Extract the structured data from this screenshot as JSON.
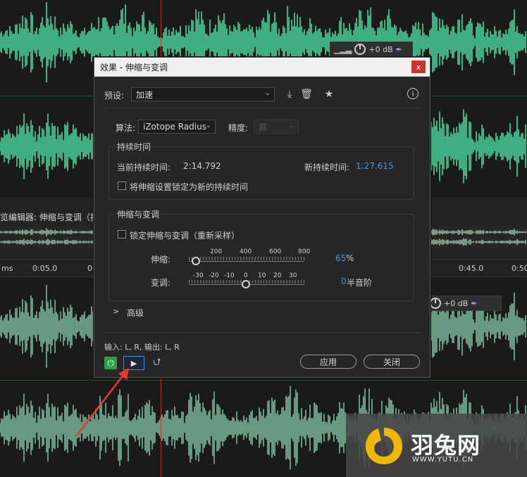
{
  "colors": {
    "wave_top": "#49d49a",
    "wave_bottom": "#7bb89c",
    "accent_blue": "#3d97e6",
    "power_green": "#2f9e4a",
    "close_red": "#c8372d"
  },
  "tracks": {
    "top_ctrl_value": "+0 dB",
    "bottom_ctrl_value": "+0 dB"
  },
  "editor": {
    "title": "览编辑器: 伸缩与变调（扫",
    "ruler_ticks": [
      "ms",
      "0:05.0",
      "0",
      "0:45.0",
      "0:50"
    ]
  },
  "dialog": {
    "title": "效果 - 伸缩与变调",
    "close": "x",
    "preset": {
      "label": "预设:",
      "value": "加速"
    },
    "algorithm": {
      "label": "算法:",
      "value": "iZotope Radius"
    },
    "precision": {
      "label": "精度:",
      "value": "高"
    },
    "duration": {
      "group_title": "持续时间",
      "current_label": "当前持续时间:",
      "current_value": "2:14.792",
      "new_label": "新持续时间:",
      "new_value": "1:27.615",
      "lock_label": "将伸缩设置锁定为新的持续时间"
    },
    "stretch_pitch": {
      "group_title": "伸缩与变调",
      "lock_label": "锁定伸缩与变调（重新采样）",
      "stretch_label": "伸缩:",
      "stretch_scale": [
        "200",
        "400",
        "600",
        "800"
      ],
      "stretch_value": "65",
      "stretch_unit": "%",
      "pitch_label": "变调:",
      "pitch_scale": [
        "-30",
        "-20",
        "-10",
        "0",
        "10",
        "20",
        "30"
      ],
      "pitch_value": "0",
      "pitch_unit": "半音阶"
    },
    "advanced": {
      "label": "高级",
      "chevron": ">"
    },
    "io": "输入: L, R,  输出: L, R",
    "apply": "应用",
    "close_btn": "关闭"
  },
  "watermark": {
    "text": "羽兔网",
    "url": "WWW.YUTU.CN"
  }
}
